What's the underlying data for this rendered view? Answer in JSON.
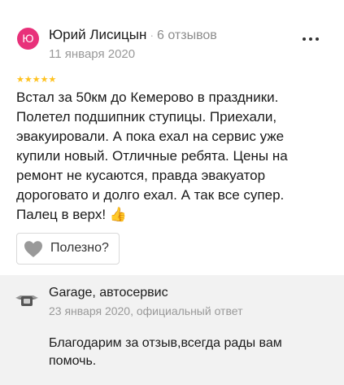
{
  "review": {
    "avatar_letter": "Ю",
    "author_name": "Юрий Лисицын",
    "separator": "·",
    "reviews_count": "6 отзывов",
    "date": "11 января 2020",
    "rating": 5,
    "stars_text": "★★★★★",
    "text": "Встал за 50км до Кемерово в праздники. Полетел подшипник ступицы. Приехали, эвакуировали. А пока ехал на сервис уже купили новый. Отличные ребята. Цены на ремонт не кусаются, правда эвакуатор дороговато и долго ехал. А так все супер. Палец в верх!",
    "thumb_emoji": "👍",
    "helpful_label": "Полезно?",
    "more_icon": "more-dots-icon",
    "heart_icon": "heart-icon"
  },
  "reply": {
    "logo_icon": "garage-logo-icon",
    "business_name": "Garage, автосервис",
    "date_and_type": "23 января 2020, официальный ответ",
    "text": "Благодарим за отзыв,всегда рады вам помочь."
  },
  "colors": {
    "avatar": "#e8317a",
    "star": "#ffc21f",
    "heart": "#999999",
    "reply_background": "#f2f2f2"
  }
}
